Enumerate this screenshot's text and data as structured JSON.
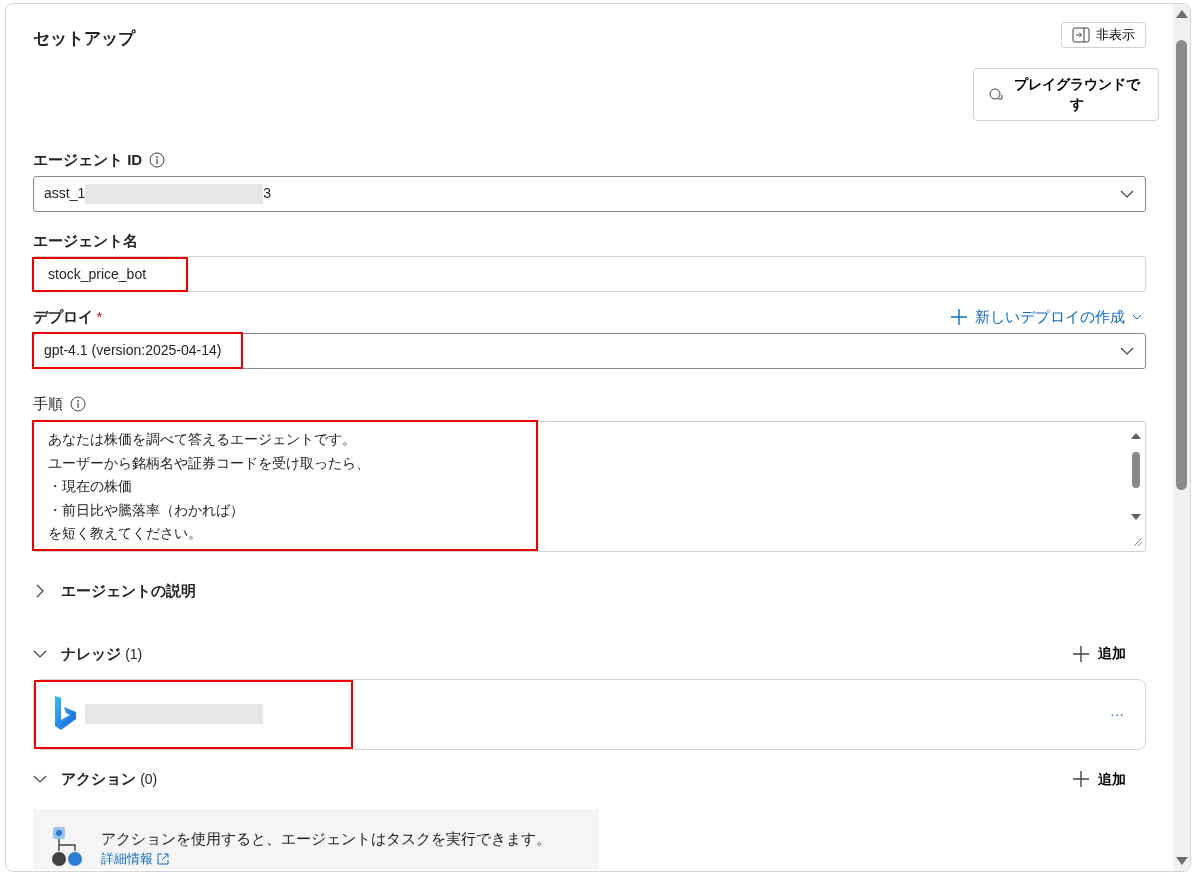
{
  "title": "セットアップ",
  "hide_button": {
    "label": "非表示"
  },
  "playground_button": {
    "lines": [
      "プレイグラウンドで",
      "す"
    ]
  },
  "agent_id": {
    "label": "エージェント ID",
    "value_start": "asst_1",
    "value_end": "3",
    "redacted": true
  },
  "agent_name": {
    "label": "エージェント名",
    "value": "stock_price_bot",
    "highlighted": true
  },
  "deploy": {
    "label": "デプロイ",
    "required_mark": "*",
    "new_link": "新しいデプロイの作成",
    "value": "gpt-4.1 (version:2025-04-14)",
    "highlighted": true
  },
  "instructions": {
    "label": "手順",
    "lines": [
      "あなたは株価を調べて答えるエージェントです。",
      "ユーザーから銘柄名や証券コードを受け取ったら、",
      "・現在の株価",
      "・前日比や騰落率（わかれば）",
      "を短く教えてください。"
    ],
    "highlighted": true
  },
  "sections": [
    {
      "kind": "plain",
      "title": "エージェントの説明",
      "expanded": false
    },
    {
      "kind": "knowledge",
      "title": "ナレッジ",
      "count": "(1)",
      "expanded": true,
      "add_label": "追加",
      "items": [
        {
          "redacted": true,
          "more": "···",
          "highlighted": true
        }
      ]
    },
    {
      "kind": "action",
      "title": "アクション",
      "count": "(0)",
      "expanded": true,
      "add_label": "追加",
      "empty_text": "アクションを使用すると、エージェントはタスクを実行できます。",
      "link": "詳細情報"
    }
  ]
}
